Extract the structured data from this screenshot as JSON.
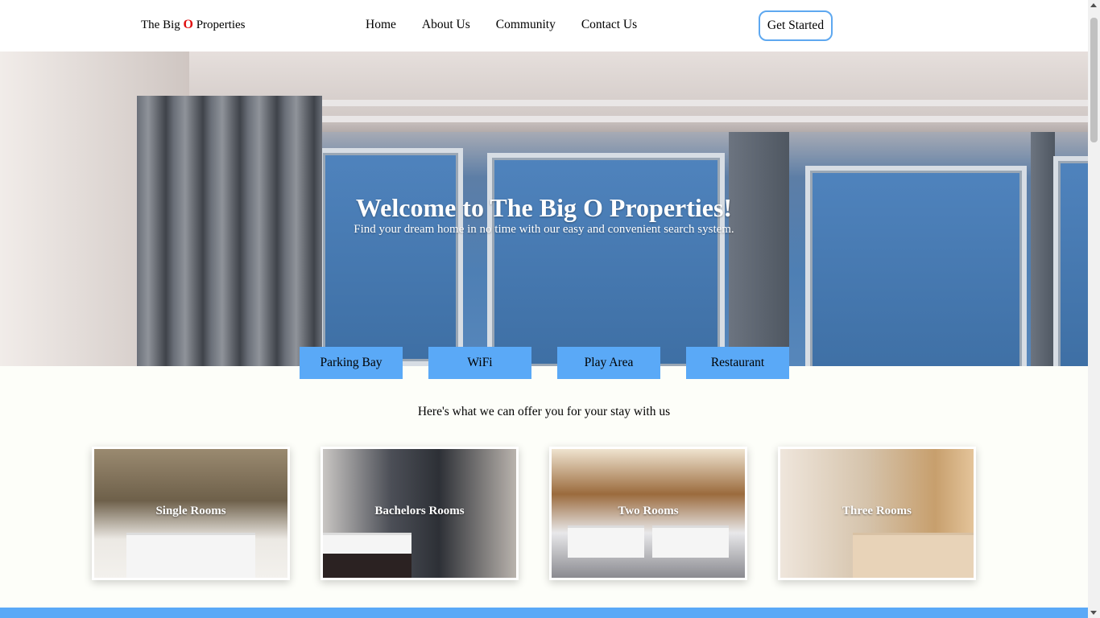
{
  "header": {
    "brand_prefix": "The Big ",
    "brand_o": "O",
    "brand_suffix": " Properties",
    "nav": [
      "Home",
      "About Us",
      "Community",
      "Contact Us"
    ],
    "cta_label": "Get Started"
  },
  "hero": {
    "title": "Welcome to The Big O Properties!",
    "subtitle": "Find your dream home in no time with our easy and convenient search system."
  },
  "amenities": [
    "Parking Bay",
    "WiFi",
    "Play Area",
    "Restaurant"
  ],
  "offer_text": "Here's what we can offer you for your stay with us",
  "rooms": [
    {
      "label": "Single Rooms"
    },
    {
      "label": "Bachelors Rooms"
    },
    {
      "label": "Two Rooms"
    },
    {
      "label": "Three Rooms"
    }
  ],
  "colors": {
    "accent": "#5aa9f7",
    "brand_o": "#e01010",
    "cta_border": "#5ea8f0",
    "page_bg": "#fdfef9"
  }
}
